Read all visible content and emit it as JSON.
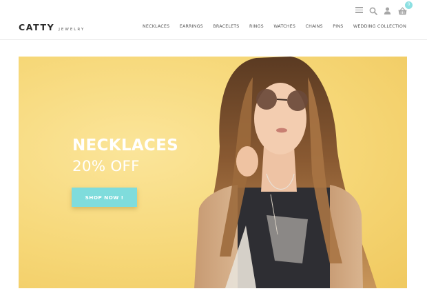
{
  "brand": {
    "name": "CATTY",
    "tagline": "JEWELRY"
  },
  "header": {
    "icons": [
      "menu-icon",
      "search-icon",
      "user-icon",
      "cart-icon"
    ],
    "cart_count": "0",
    "nav": [
      {
        "label": "NECKLACES"
      },
      {
        "label": "EARRINGS"
      },
      {
        "label": "BRACELETS"
      },
      {
        "label": "RINGS"
      },
      {
        "label": "WATCHES"
      },
      {
        "label": "CHAINS"
      },
      {
        "label": "PINS"
      },
      {
        "label": "WEDDING COLLECTION"
      }
    ]
  },
  "hero": {
    "title": "NECKLACES",
    "subtitle": "20% OFF",
    "button_label": "SHOP NOW !",
    "colors": {
      "background": "#f6d777",
      "button": "#7fdcdc",
      "text": "#ffffff",
      "badge": "#8de0e2"
    }
  }
}
